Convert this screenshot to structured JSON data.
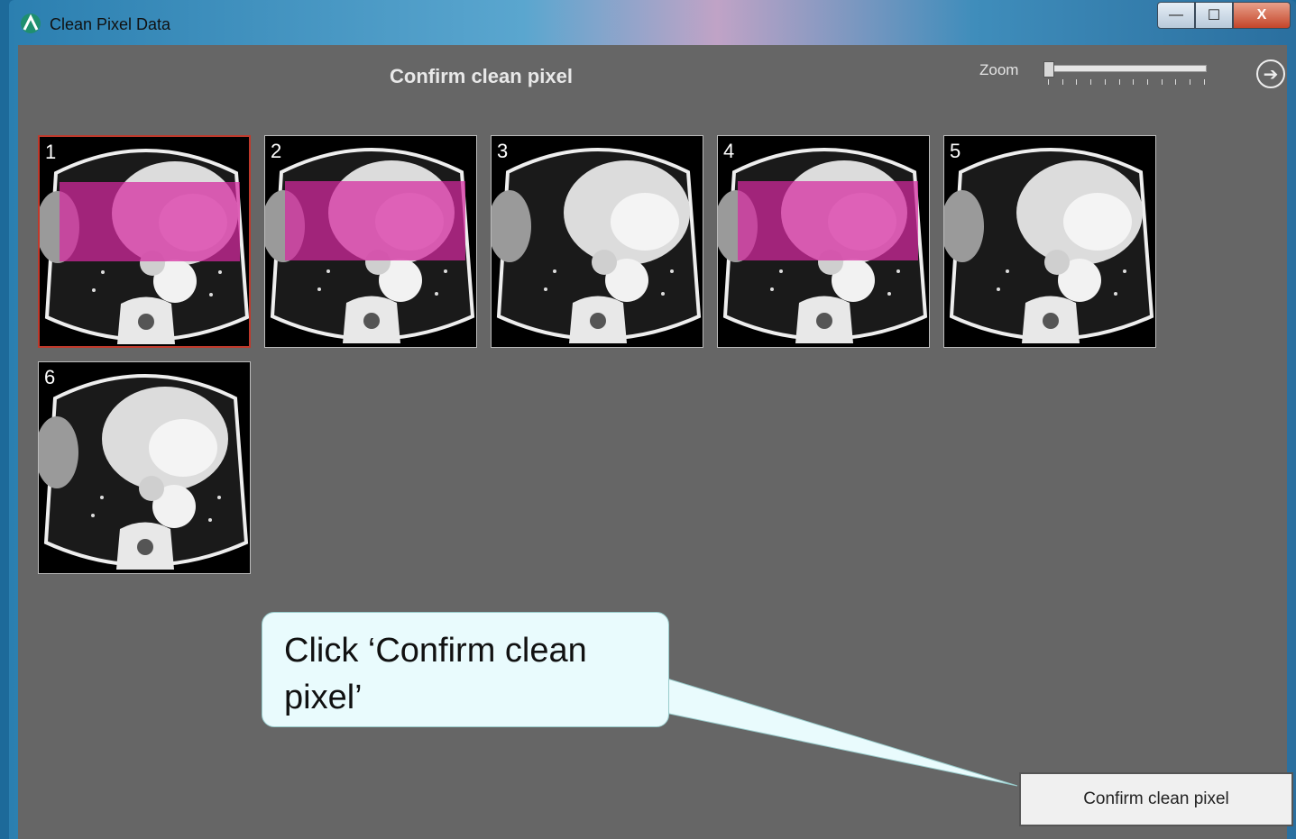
{
  "window": {
    "title": "Clean Pixel Data",
    "buttons": {
      "minimize": "—",
      "maximize": "☐",
      "close": "X"
    }
  },
  "header": {
    "title": "Confirm clean pixel",
    "zoom_label": "Zoom",
    "zoom_level": 0.0,
    "back_icon": "arrow-left-circle-icon"
  },
  "thumbnails": [
    {
      "number": "1",
      "selected": true,
      "masked": true
    },
    {
      "number": "2",
      "selected": false,
      "masked": true
    },
    {
      "number": "3",
      "selected": false,
      "masked": false
    },
    {
      "number": "4",
      "selected": false,
      "masked": true
    },
    {
      "number": "5",
      "selected": false,
      "masked": false
    },
    {
      "number": "6",
      "selected": false,
      "masked": false
    }
  ],
  "callout": {
    "text": "Click ‘Confirm clean pixel’"
  },
  "confirm_button": {
    "label": "Confirm clean pixel"
  },
  "colors": {
    "mask": "#d628a0",
    "selected_border": "#c0392b",
    "background": "#666666"
  }
}
